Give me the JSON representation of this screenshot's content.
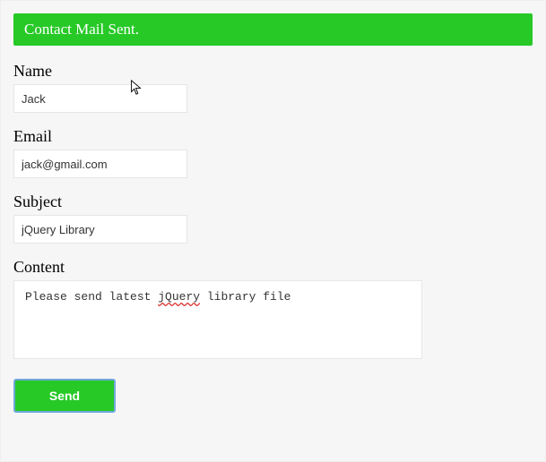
{
  "banner": {
    "message": "Contact Mail Sent."
  },
  "form": {
    "name": {
      "label": "Name",
      "value": "Jack"
    },
    "email": {
      "label": "Email",
      "value": "jack@gmail.com"
    },
    "subject": {
      "label": "Subject",
      "value": "jQuery Library"
    },
    "content": {
      "label": "Content",
      "value_pre": "Please send latest ",
      "value_spell": "jQuery",
      "value_post": " library file"
    },
    "submit_label": "Send"
  }
}
